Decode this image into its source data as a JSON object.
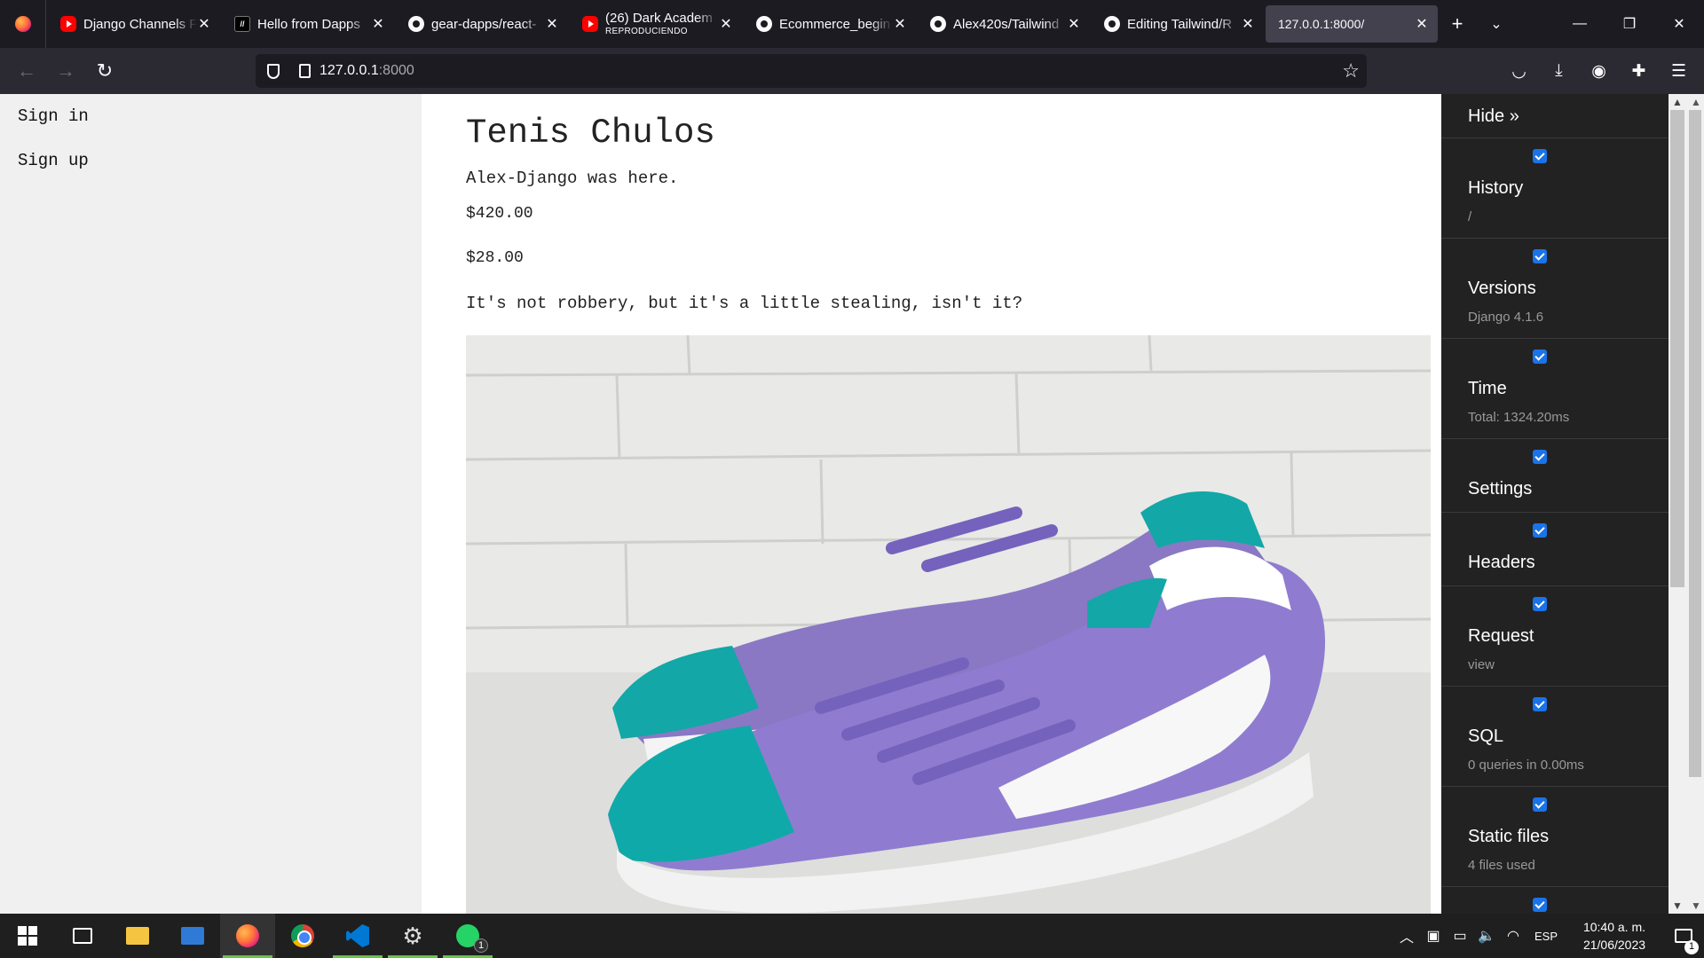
{
  "browser": {
    "tabs": [
      {
        "title": "Django Channels F",
        "subtitle": "",
        "favicon": "youtube-icon"
      },
      {
        "title": "Hello from Dapps",
        "subtitle": "",
        "favicon": "dapp-icon"
      },
      {
        "title": "gear-dapps/react-",
        "subtitle": "",
        "favicon": "github-icon"
      },
      {
        "title": "(26) Dark Academ",
        "subtitle": "REPRODUCIENDO",
        "favicon": "youtube-icon"
      },
      {
        "title": "Ecommerce_begin",
        "subtitle": "",
        "favicon": "github-icon"
      },
      {
        "title": "Alex420s/Tailwind",
        "subtitle": "",
        "favicon": "github-icon"
      },
      {
        "title": "Editing Tailwind/R",
        "subtitle": "",
        "favicon": "github-icon"
      },
      {
        "title": "127.0.0.1:8000/",
        "subtitle": "",
        "favicon": "none",
        "active": true
      }
    ],
    "url_host": "127.0.0.1",
    "url_port": ":8000"
  },
  "page": {
    "nav": {
      "sign_in": "Sign in",
      "sign_up": "Sign up"
    },
    "product": {
      "title": "Tenis Chulos",
      "description": "Alex-Django was here.",
      "price_1": "$420.00",
      "price_2": "$28.00",
      "note": "It's not robbery, but it's a little stealing, isn't it?",
      "image": "sneaker-photo"
    }
  },
  "debug_toolbar": {
    "hide_label": "Hide »",
    "panels": [
      {
        "title": "History",
        "subtitle": "/",
        "checked": true
      },
      {
        "title": "Versions",
        "subtitle": "Django 4.1.6",
        "checked": true
      },
      {
        "title": "Time",
        "subtitle": "Total: 1324.20ms",
        "checked": true
      },
      {
        "title": "Settings",
        "subtitle": "",
        "checked": true
      },
      {
        "title": "Headers",
        "subtitle": "",
        "checked": true
      },
      {
        "title": "Request",
        "subtitle": "view",
        "checked": true
      },
      {
        "title": "SQL",
        "subtitle": "0 queries in 0.00ms",
        "checked": true
      },
      {
        "title": "Static files",
        "subtitle": "4 files used",
        "checked": true
      }
    ]
  },
  "taskbar": {
    "lang": "ESP",
    "time": "10:40 a. m.",
    "date": "21/06/2023",
    "whatsapp_badge": "1",
    "notifications_badge": "1"
  }
}
